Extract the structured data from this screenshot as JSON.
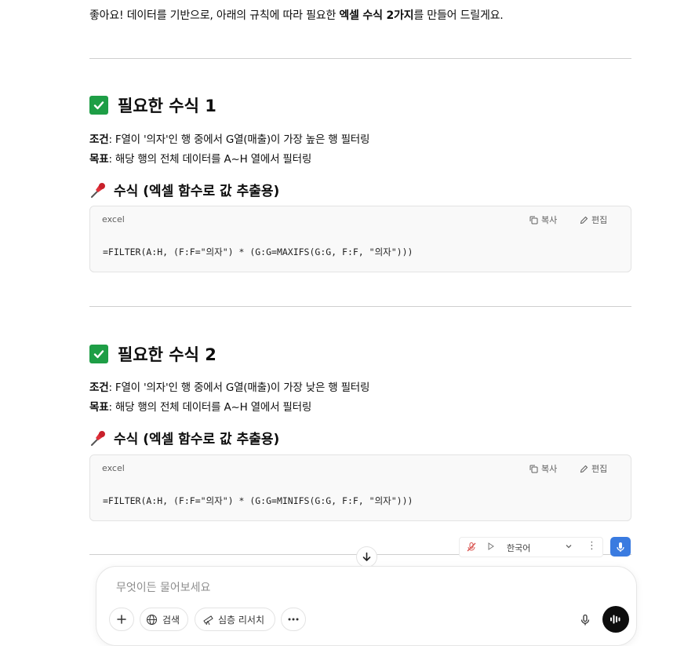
{
  "intro": {
    "before": "좋아요! 데이터를 기반으로, 아래의 규칙에 따라 필요한 ",
    "bold": "엑셀 수식 2가지",
    "after": "를 만들어 드릴게요."
  },
  "sections": [
    {
      "heading": "필요한 수식 1",
      "condition_label": "조건",
      "condition_text": ": F열이 '의자'인 행 중에서 G열(매출)이 가장 높은 행 필터링",
      "goal_label": "목표",
      "goal_text": ": 해당 행의 전체 데이터를 A~H 열에서 필터링",
      "formula_heading": "수식 (엑셀 함수로 값 추출용)",
      "code_lang": "excel",
      "copy_label": "복사",
      "edit_label": "편집",
      "code": "=FILTER(A:H, (F:F=\"의자\") * (G:G=MAXIFS(G:G, F:F, \"의자\")))"
    },
    {
      "heading": "필요한 수식 2",
      "condition_label": "조건",
      "condition_text": ": F열이 '의자'인 행 중에서 G열(매출)이 가장 낮은 행 필터링",
      "goal_label": "목표",
      "goal_text": ": 해당 행의 전체 데이터를 A~H 열에서 필터링",
      "formula_heading": "수식 (엑셀 함수로 값 추출용)",
      "code_lang": "excel",
      "copy_label": "복사",
      "edit_label": "편집",
      "code": "=FILTER(A:H, (F:F=\"의자\") * (G:G=MINIFS(G:G, F:F, \"의자\")))"
    }
  ],
  "voice": {
    "language": "한국어"
  },
  "composer": {
    "placeholder": "무엇이든 물어보세요",
    "search_label": "검색",
    "deep_research_label": "심층 리서치"
  },
  "colors": {
    "check_green": "#1e9e46",
    "voice_blue": "#3a7be0",
    "send_black": "#0d0d0d"
  },
  "icons": [
    "check-icon",
    "pin-icon",
    "copy-icon",
    "edit-icon",
    "arrow-down-icon",
    "mic-off-icon",
    "play-icon",
    "chevron-down-icon",
    "more-icon",
    "mic-icon",
    "plus-icon",
    "globe-icon",
    "telescope-icon",
    "voice-wave-icon"
  ]
}
